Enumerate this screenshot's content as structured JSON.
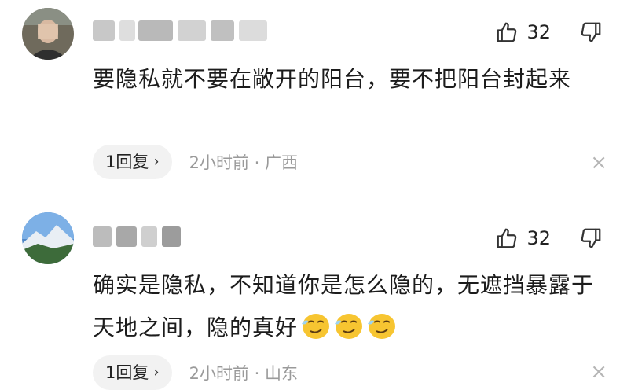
{
  "comments": [
    {
      "likes": "32",
      "text": "要隐私就不要在敞开的阳台，要不把阳台封起来",
      "reply_label": "1回复",
      "reply_arrow": "›",
      "meta": "2小时前 · 广西",
      "close": "×"
    },
    {
      "likes": "32",
      "text": "确实是隐私，不知道你是怎么隐的，无遮挡暴露于天地之间，隐的真好",
      "reply_label": "1回复",
      "reply_arrow": "›",
      "meta": "2小时前 · 山东",
      "close": "×"
    }
  ],
  "icons": {
    "like": "thumbs-up-icon",
    "dislike": "thumbs-down-icon",
    "close": "close-icon",
    "emoji": "smirk-emoji-icon"
  },
  "colors": {
    "text": "#1c1c1c",
    "meta": "#9a9a9a",
    "reply_bg": "#f2f2f2",
    "icon": "#b5b5b5"
  }
}
